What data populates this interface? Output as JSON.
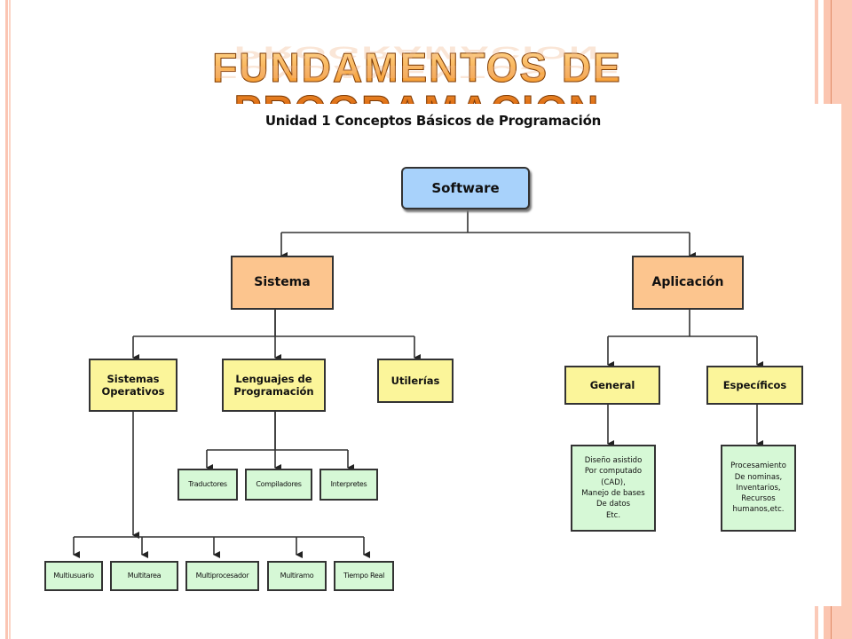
{
  "slide": {
    "title": "FUNDAMENTOS DE PROGRAMACION",
    "accent_colors": {
      "title_orange": "#e9781c",
      "stripe_peach": "#fbc5b3"
    }
  },
  "diagram": {
    "subtitle": "Unidad 1 Conceptos Básicos de Programación",
    "colors": {
      "root": "#a8d2fb",
      "level1": "#fcc58e",
      "level2": "#fbf59a",
      "leaf": "#d6f8d6"
    },
    "nodes": {
      "software": "Software",
      "sistema": "Sistema",
      "aplicacion": "Aplicación",
      "sistemas_operativos": "Sistemas\nOperativos",
      "lenguajes": "Lenguajes de\nProgramación",
      "utilerias": "Utilerías",
      "general": "General",
      "especificos": "Específicos",
      "traductores": "Traductores",
      "compiladores": "Compiladores",
      "interpretes": "Interpretes",
      "multiusuario": "Multiusuario",
      "multitarea": "Multitarea",
      "multiprocesador": "Multiprocesador",
      "multiramo": "Multiramo",
      "tiempo_real": "Tiempo Real",
      "general_desc": "Diseño asistido\nPor computado\n(CAD),\nManejo de bases\nDe datos\nEtc.",
      "especificos_desc": "Procesamiento\nDe nominas,\nInventarios,\nRecursos\nhumanos,etc."
    }
  }
}
